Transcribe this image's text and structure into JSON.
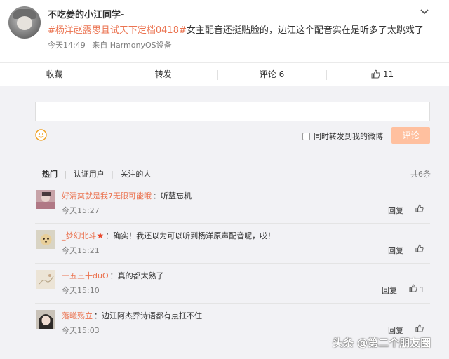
{
  "post": {
    "username": "不吃姜的小江同学-",
    "hashtag": "#杨洋赵露思且试天下定档0418#",
    "text": "女主配音还挺贴脸的，边江这个配音实在是听多了太跳戏了",
    "time": "今天14:49",
    "source": "来自 HarmonyOS设备"
  },
  "actions": {
    "collect": "收藏",
    "forward": "转发",
    "comment": "评论 6",
    "like": "11"
  },
  "composer": {
    "forward_label": "同时转发到我的微博",
    "submit_label": "评论"
  },
  "filters": {
    "hot": "热门",
    "verified": "认证用户",
    "following": "关注的人",
    "total": "共6条"
  },
  "comments": [
    {
      "name": "好清爽就是我7无限可能哦",
      "text": "：听蓝忘机",
      "time": "今天15:27",
      "reply": "回复",
      "likes": ""
    },
    {
      "name": "_梦幻北斗",
      "badge": "★",
      "text": "：确实！我还以为可以听到杨洋原声配音呢，哎！",
      "time": "今天15:21",
      "reply": "回复",
      "likes": ""
    },
    {
      "name": "一五三十duO",
      "text": "：真的都太熟了",
      "time": "今天15:10",
      "reply": "回复",
      "likes": "1"
    },
    {
      "name": "落曦殇立",
      "text": "：边江阿杰乔诗语都有点扛不住",
      "time": "今天15:03",
      "reply": "回复",
      "likes": ""
    }
  ],
  "watermark": "头条 @第二个朋友圈",
  "colors": {
    "accent": "#eb7350",
    "submit_disabled": "#ffc09f",
    "background": "#f2f2f5"
  }
}
